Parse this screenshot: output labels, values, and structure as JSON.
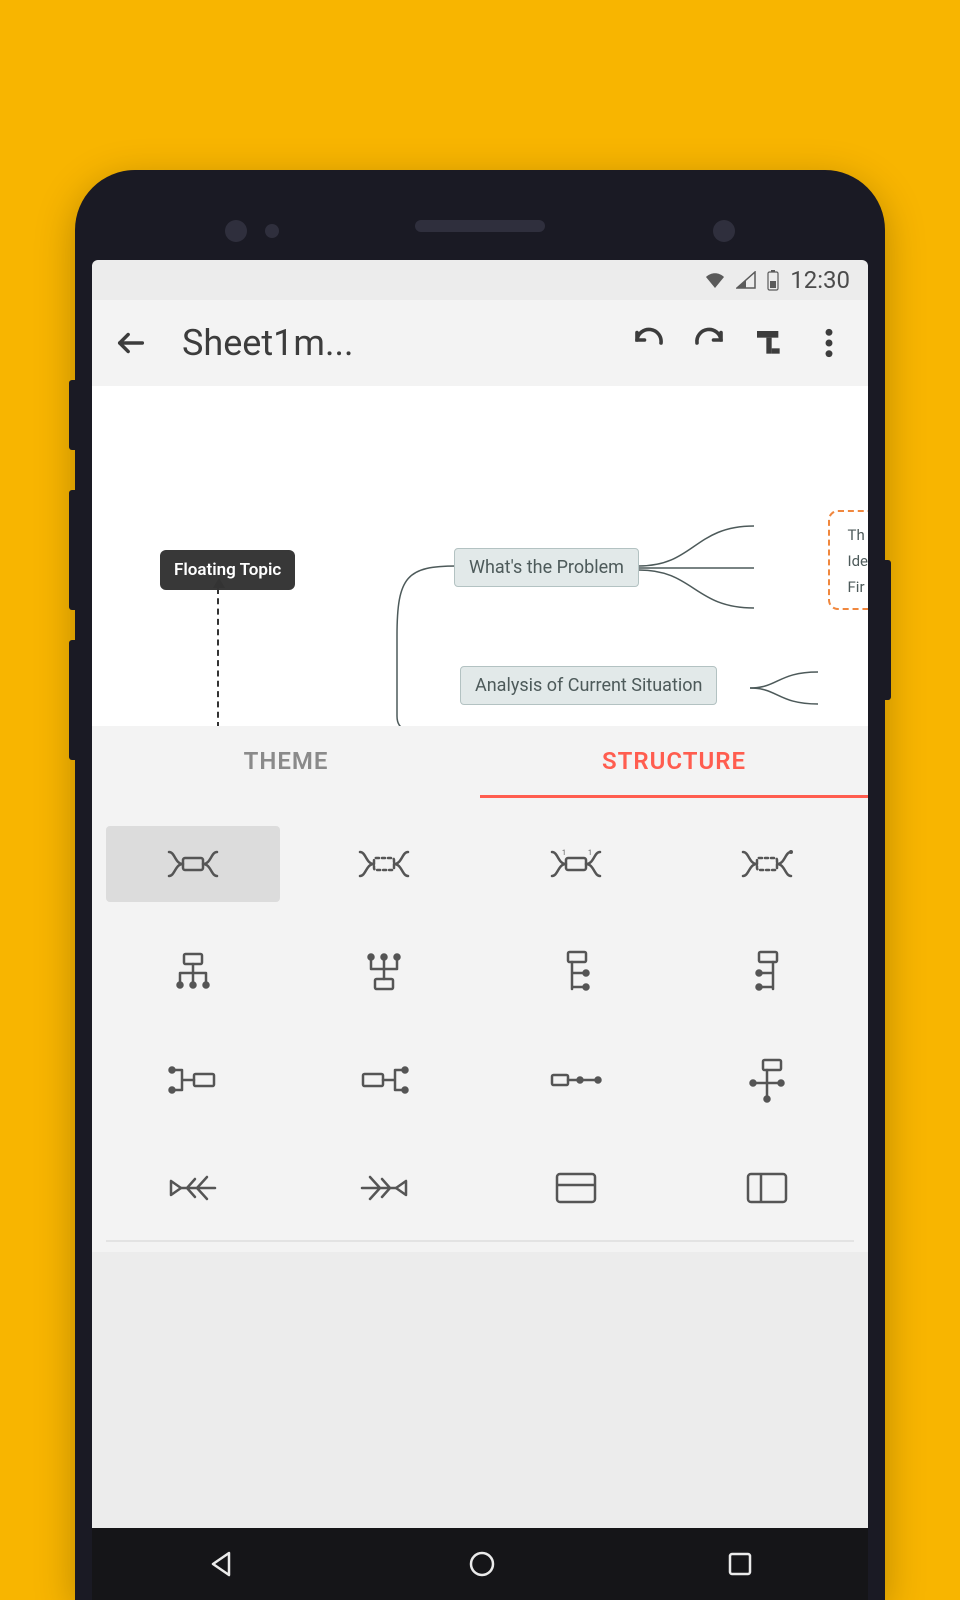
{
  "status": {
    "time": "12:30"
  },
  "appbar": {
    "title": "Sheet1m..."
  },
  "canvas": {
    "floating_topic": "Floating Topic",
    "node_problem": "What's the Problem",
    "node_analysis": "Analysis of Current Situation",
    "side_items": [
      "Th",
      "Ide",
      "Fir"
    ]
  },
  "tabs": {
    "theme": "THEME",
    "structure": "STRUCTURE",
    "active": "structure"
  },
  "structure_options": [
    "map-balanced",
    "map-clockwise",
    "map-counter",
    "map-numbered",
    "org-down",
    "org-up",
    "tree-right",
    "tree-left-variant",
    "logic-right",
    "logic-left",
    "timeline",
    "tree-branch",
    "fishbone-left",
    "fishbone-right",
    "table",
    "column"
  ]
}
